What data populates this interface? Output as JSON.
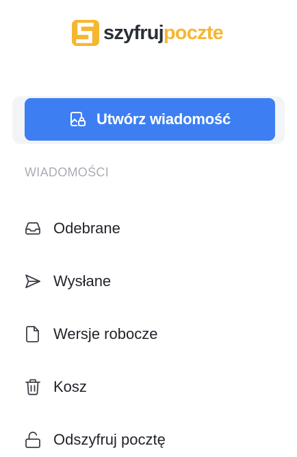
{
  "logo": {
    "part1": "szyfruj",
    "part2": "poczte",
    "mark_letter": "S",
    "brand_color": "#f5b731"
  },
  "compose": {
    "label": "Utwórz wiadomość",
    "icon": "compose-lock-icon",
    "color": "#3d7ff2"
  },
  "section": {
    "label": "WIADOMOŚCI"
  },
  "nav": {
    "items": [
      {
        "label": "Odebrane",
        "icon": "inbox-icon"
      },
      {
        "label": "Wysłane",
        "icon": "send-icon"
      },
      {
        "label": "Wersje robocze",
        "icon": "draft-file-icon"
      },
      {
        "label": "Kosz",
        "icon": "trash-icon"
      },
      {
        "label": "Odszyfruj pocztę",
        "icon": "unlock-icon"
      }
    ]
  }
}
